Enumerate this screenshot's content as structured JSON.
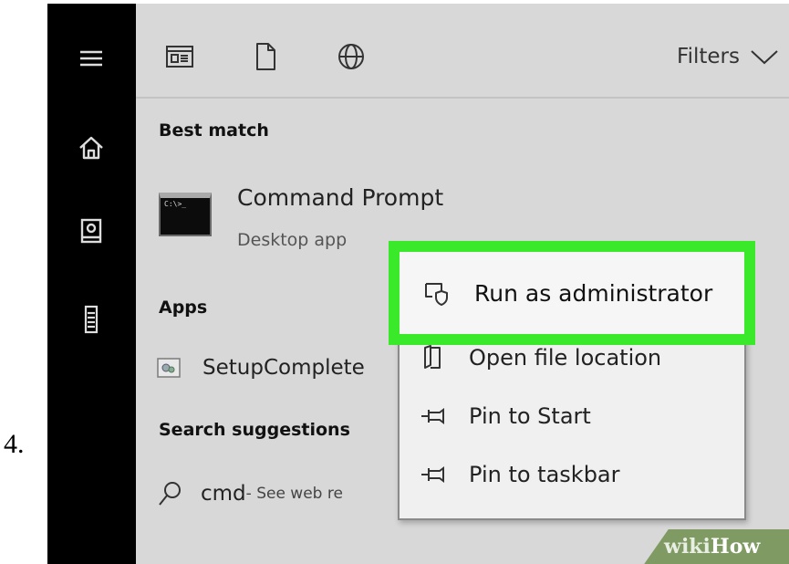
{
  "step_number": "4.",
  "toolbar": {
    "filters_label": "Filters"
  },
  "sections": {
    "best_match": "Best match",
    "apps": "Apps",
    "search_suggestions": "Search suggestions"
  },
  "best_match_app": {
    "title": "Command Prompt",
    "subtitle": "Desktop app",
    "icon_text": "C:\\>_"
  },
  "apps_list": [
    {
      "label": "SetupComplete"
    }
  ],
  "suggestion": {
    "query": "cmd",
    "hint": " - See web re"
  },
  "context_menu": {
    "items": [
      {
        "label": "Run as administrator",
        "icon": "shield-icon"
      },
      {
        "label": "Open file location",
        "icon": "folder-icon"
      },
      {
        "label": "Pin to Start",
        "icon": "pin-icon"
      },
      {
        "label": "Pin to taskbar",
        "icon": "pin-icon"
      }
    ]
  },
  "watermark": {
    "part1": "wiki",
    "part2": "How"
  },
  "colors": {
    "highlight": "#3ae92a",
    "rail": "#000000",
    "panel": "#d8d8d8",
    "menu": "#f0f0f0"
  }
}
